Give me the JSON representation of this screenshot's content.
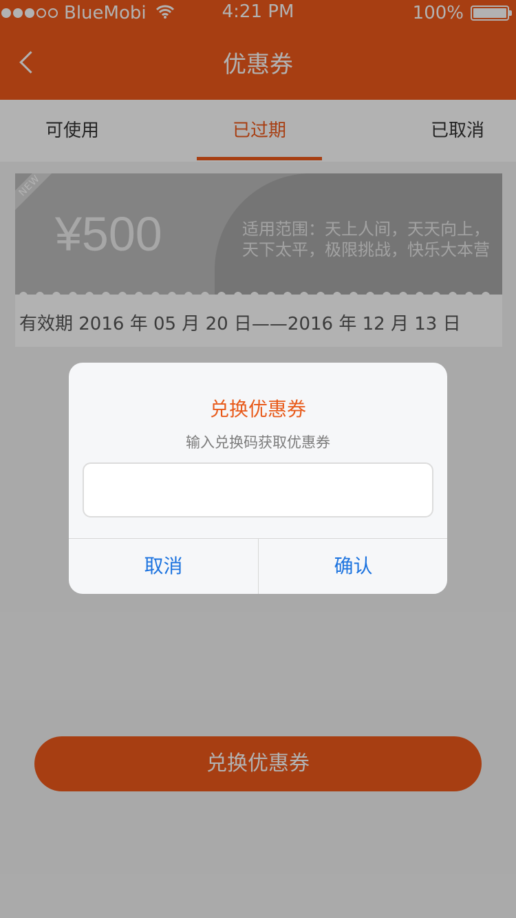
{
  "status_bar": {
    "carrier": "BlueMobi",
    "time": "4:21 PM",
    "battery": "100%",
    "battery_level": 1.0,
    "signal_bars_filled": 3,
    "signal_bars_total": 5
  },
  "nav": {
    "title": "优惠券",
    "back_icon": "chevron-left-icon"
  },
  "tabs": [
    {
      "label": "可使用",
      "active": false
    },
    {
      "label": "已过期",
      "active": true
    },
    {
      "label": "已取消",
      "active": false
    }
  ],
  "coupon": {
    "badge": "NEW",
    "price": "¥500",
    "scope_line1": "适用范围：天上人间，天天向上，",
    "scope_line2": "天下太平，极限挑战，快乐大本营",
    "validity": "有效期 2016 年 05 月 20 日——2016 年 12 月 13 日"
  },
  "bottom_button": {
    "label": "兑换优惠券"
  },
  "dialog": {
    "title": "兑换优惠券",
    "subtitle": "输入兑换码获取优惠券",
    "input_value": "",
    "input_placeholder": "",
    "cancel_label": "取消",
    "confirm_label": "确认"
  },
  "colors": {
    "brand": "#f05a1a",
    "dialog_title": "#e85a1a",
    "dialog_button": "#1c73df",
    "overlay": "rgba(0,0,0,0.30)"
  }
}
